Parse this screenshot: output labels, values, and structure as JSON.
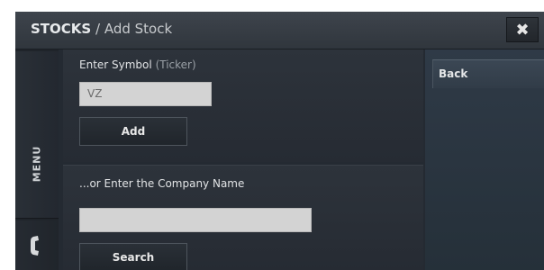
{
  "header": {
    "app_name": "STOCKS",
    "separator": " / ",
    "page_title": "Add Stock",
    "close_glyph": "✖"
  },
  "left_rail": {
    "menu_label": "MENU",
    "phone_icon": "phone-icon"
  },
  "symbol_section": {
    "label": "Enter Symbol",
    "hint": "(Ticker)",
    "input_value": "VZ",
    "add_label": "Add"
  },
  "company_section": {
    "label": "...or Enter the Company Name",
    "input_value": "",
    "search_label": "Search"
  },
  "right_panel": {
    "back_label": "Back"
  },
  "colors": {
    "background": "#242a32",
    "field": "#d3d3d3",
    "panel_right": "#2f3a47"
  }
}
